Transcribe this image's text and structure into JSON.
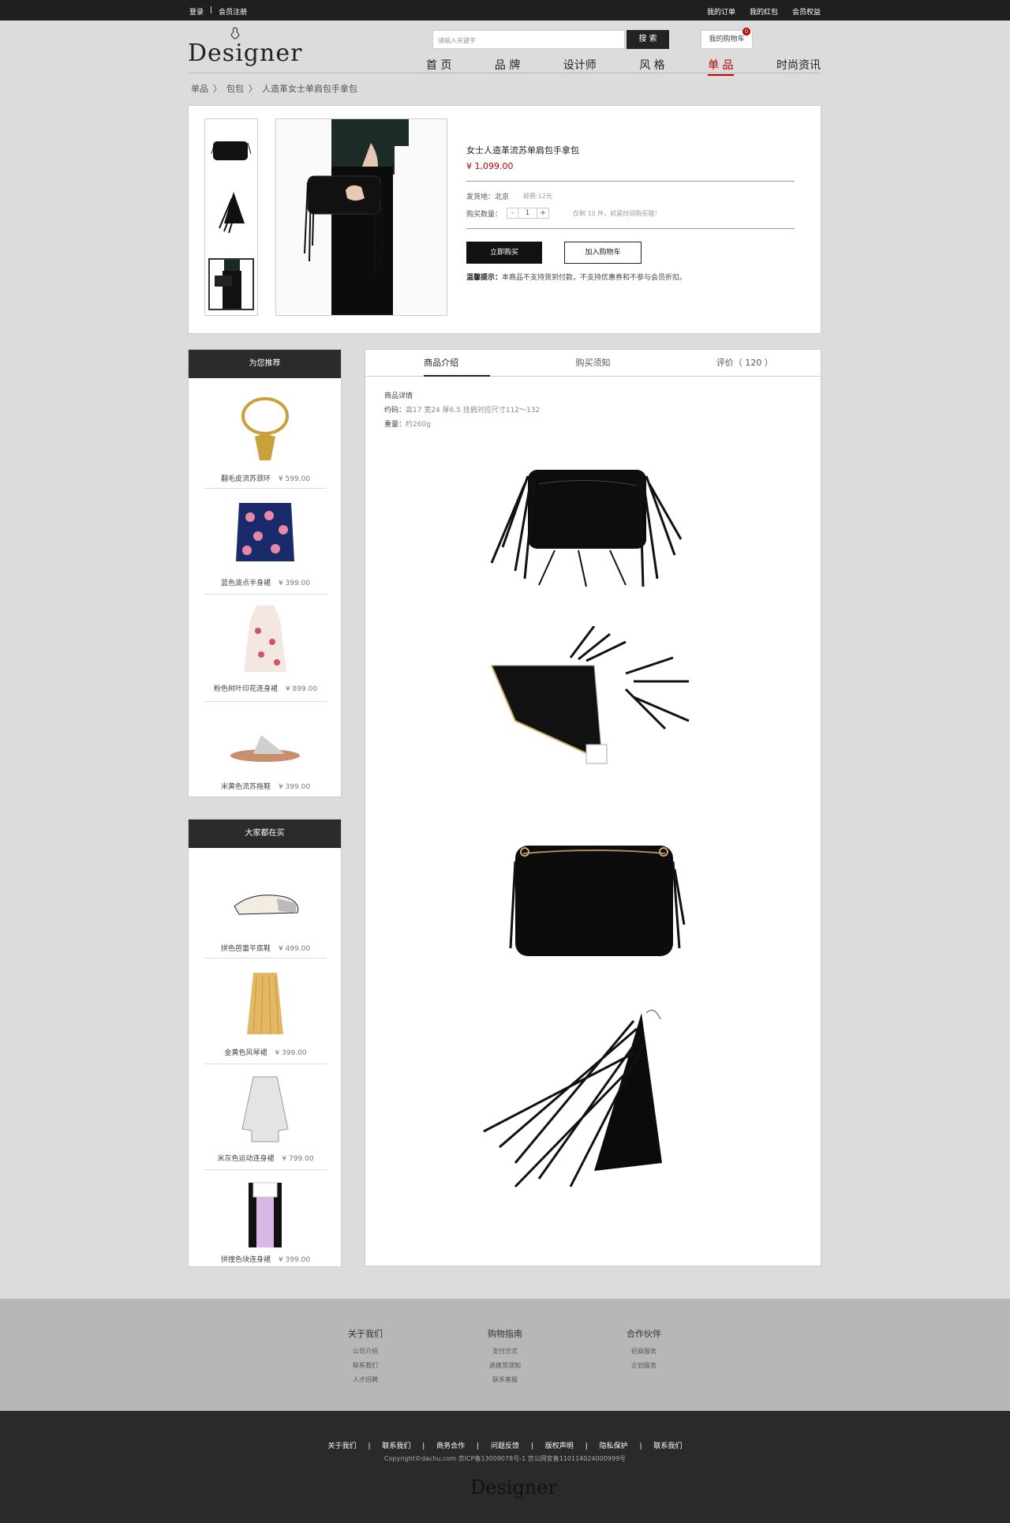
{
  "topbar": {
    "login": "登录",
    "sep": "|",
    "register": "会员注册",
    "links": [
      "我的订单",
      "我的红包",
      "会员权益"
    ]
  },
  "header": {
    "logo": "Designer",
    "search_placeholder": "请输入关键字",
    "search_button": "搜 索",
    "cart_label": "我的购物车",
    "cart_count": "0"
  },
  "nav": {
    "items": [
      "首 页",
      "品 牌",
      "设计师",
      "风 格",
      "单 品",
      "时尚资讯"
    ],
    "active_index": 4
  },
  "breadcrumb": [
    "单品",
    "〉",
    "包包",
    "〉",
    "人造革女士单肩包手拿包"
  ],
  "product": {
    "title": "女士人造革流苏单肩包手拿包",
    "price": "¥ 1,099.00",
    "ship_label": "发货地：北京",
    "ship_fee": "邮费:12元",
    "qty_label": "购买数量：",
    "qty_minus": "-",
    "qty_value": "1",
    "qty_plus": "+",
    "stock": "仅剩  10  件，抓紧时间购买哦！",
    "buy_now": "立即购买",
    "add_cart": "加入购物车",
    "tip_label": "温馨提示：",
    "tip_text": "本商品不支持货到付款，不支持优惠券和不参与会员折扣。"
  },
  "recommend": {
    "title": "为您推荐",
    "items": [
      {
        "name": "翻毛皮流苏颈环",
        "price": "¥ 599.00"
      },
      {
        "name": "蓝色波点半身裙",
        "price": "¥ 399.00"
      },
      {
        "name": "粉色树叶印花连身裙",
        "price": "¥ 899.00"
      },
      {
        "name": "米黄色流苏拖鞋",
        "price": "¥ 399.00"
      }
    ]
  },
  "popular": {
    "title": "大家都在买",
    "items": [
      {
        "name": "拼色芭蕾平底鞋",
        "price": "¥ 499.00"
      },
      {
        "name": "金黄色风琴裙",
        "price": "¥ 399.00"
      },
      {
        "name": "米灰色运动连身裙",
        "price": "¥ 799.00"
      },
      {
        "name": "拼撞色块连身裙",
        "price": "¥ 399.00"
      }
    ]
  },
  "detail": {
    "tabs": [
      "商品介绍",
      "购买须知",
      "评价（ 120 ）"
    ],
    "heading": "商品详情",
    "size_label": "约码：",
    "size_value": "高17 宽24 厚6.5 挂肩对应尺寸112～132",
    "weight_label": "重量：",
    "weight_value": "约260g"
  },
  "footer": {
    "cols": [
      {
        "title": "关于我们",
        "items": [
          "公司介绍",
          "联系我们",
          "人才招聘"
        ]
      },
      {
        "title": "购物指南",
        "items": [
          "支付方式",
          "退换货须知",
          "联系客服"
        ]
      },
      {
        "title": "合作伙伴",
        "items": [
          "招商服务",
          "企划服务"
        ]
      }
    ],
    "links": [
      "关于我们",
      "|",
      "联系我们",
      "|",
      "商务合作",
      "|",
      "问题反馈",
      "|",
      "版权声明",
      "|",
      "隐私保护",
      "|",
      "联系我们"
    ],
    "copyright": "Copyright©dachu.com    京ICP备13009078号-1    京公网安备110114024000999号",
    "logo": "Designer"
  },
  "colors": {
    "accent": "#b00000",
    "dark": "#1f1f1f",
    "bg": "#dcdcdc"
  }
}
